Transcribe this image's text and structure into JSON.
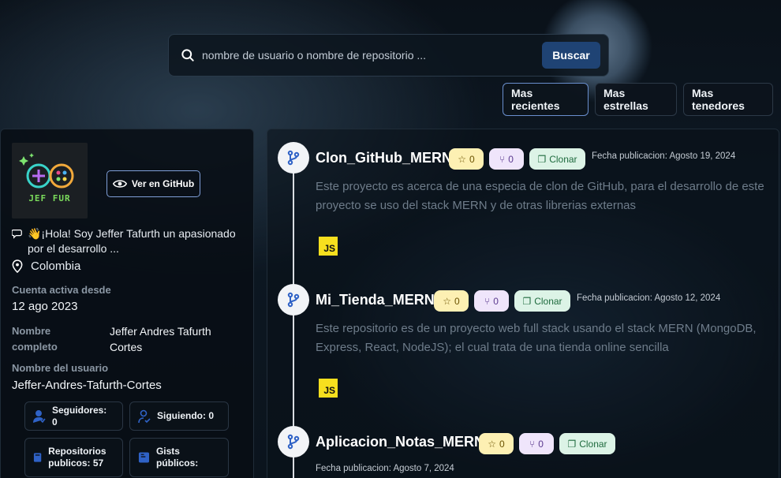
{
  "search": {
    "placeholder": "nombre de usuario o nombre de repositorio ...",
    "button": "Buscar"
  },
  "sort_tabs": [
    {
      "label": "Mas recientes",
      "active": true
    },
    {
      "label": "Mas estrellas",
      "active": false
    },
    {
      "label": "Mas tenedores",
      "active": false
    }
  ],
  "profile": {
    "avatar_text": "JEF FUR",
    "github_button": "Ver en GitHub",
    "bio": "👋¡Hola! Soy Jeffer Tafurth un apasionado por el desarrollo ...",
    "location": "Colombia",
    "active_since_label": "Cuenta activa desde",
    "active_since": "12 ago 2023",
    "full_name_label": "Nombre completo",
    "full_name": "Jeffer Andres Tafurth Cortes",
    "username_label": "Nombre del usuario",
    "username": "Jeffer-Andres-Tafurth-Cortes",
    "stats": {
      "followers": "Seguidores: 0",
      "following": "Siguiendo: 0",
      "public_repos": "Repositorios publicos: 57",
      "public_gists": "Gists públicos:"
    }
  },
  "repos": [
    {
      "name": "Clon_GitHub_MERN",
      "stars": "0",
      "forks": "0",
      "clone_label": "Clonar",
      "date": "Fecha publicacion: Agosto 19, 2024",
      "description": "Este proyecto es acerca de una especia de clon de GitHub, para el desarrollo de este proyecto se uso del stack MERN y de otras librerias externas",
      "language": "JS"
    },
    {
      "name": "Mi_Tienda_MERN",
      "stars": "0",
      "forks": "0",
      "clone_label": "Clonar",
      "date": "Fecha publicacion: Agosto 12, 2024",
      "description": "Este repositorio es de un proyecto web full stack usando el stack MERN (MongoDB, Express, React, NodeJS); el cual trata de una tienda online sencilla",
      "language": "JS"
    },
    {
      "name": "Aplicacion_Notas_MERN",
      "stars": "0",
      "forks": "0",
      "clone_label": "Clonar",
      "date": "Fecha publicacion: Agosto 7, 2024"
    }
  ],
  "colors": {
    "accent": "#1f4374",
    "star_bg": "#fdf0b3",
    "fork_bg": "#efe5fb",
    "clone_bg": "#dcf3e6",
    "js_yellow": "#f7df1e"
  }
}
